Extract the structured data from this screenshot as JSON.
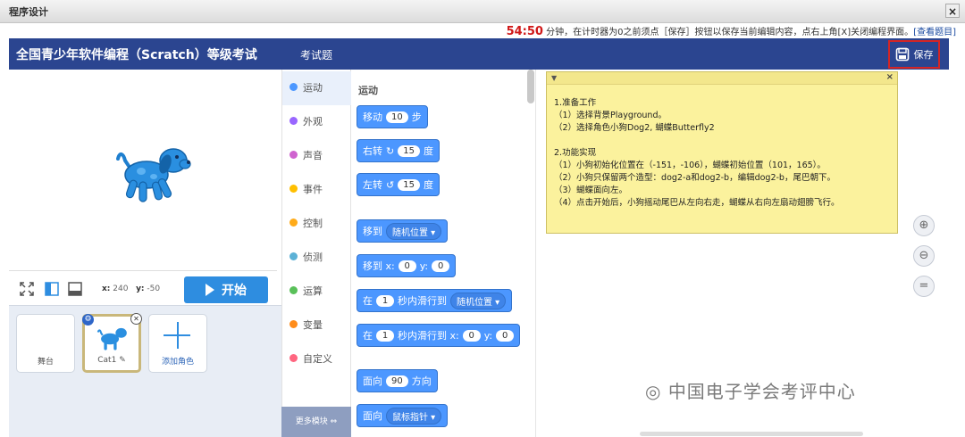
{
  "window": {
    "title": "程序设计",
    "close_label": "×"
  },
  "notice": {
    "timer": "54:50",
    "message": " 分钟，在计时器为0之前须点［保存］按钮以保存当前编辑内容，点右上角[X]关闭编程界面。",
    "link": "[查看题目]"
  },
  "header": {
    "title": "全国青少年软件编程（Scratch）等级考试",
    "tab": "考试题",
    "save_label": "保存"
  },
  "stage": {
    "coord_x_label": "x:",
    "coord_x": "240",
    "coord_y_label": "y:",
    "coord_y": "-50",
    "start_label": "开始"
  },
  "sprites": {
    "stage_label": "舞台",
    "sprite_name": "Cat1",
    "add_label": "添加角色"
  },
  "categories": [
    {
      "label": "运动",
      "color": "#4c97ff"
    },
    {
      "label": "外观",
      "color": "#9966ff"
    },
    {
      "label": "声音",
      "color": "#cf63cf"
    },
    {
      "label": "事件",
      "color": "#ffbf00"
    },
    {
      "label": "控制",
      "color": "#ffab19"
    },
    {
      "label": "侦测",
      "color": "#5cb1d6"
    },
    {
      "label": "运算",
      "color": "#59c059"
    },
    {
      "label": "变量",
      "color": "#ff8c1a"
    },
    {
      "label": "自定义",
      "color": "#ff6680"
    }
  ],
  "more_blocks": "更多模块",
  "palette": {
    "header": "运动",
    "move": {
      "a": "移动",
      "n": "10",
      "b": "步"
    },
    "turn_right": {
      "a": "右转",
      "n": "15",
      "b": "度"
    },
    "turn_left": {
      "a": "左转",
      "n": "15",
      "b": "度"
    },
    "goto": {
      "a": "移到",
      "dd": "随机位置"
    },
    "goto_xy": {
      "a": "移到 x:",
      "x": "0",
      "b": "y:",
      "y": "0"
    },
    "glide": {
      "a": "在",
      "n": "1",
      "b": "秒内滑行到",
      "dd": "随机位置"
    },
    "glide_xy": {
      "a": "在",
      "n": "1",
      "b": "秒内滑行到 x:",
      "x": "0",
      "c": "y:",
      "y": "0"
    },
    "point_dir": {
      "a": "面向",
      "n": "90",
      "b": "方向"
    },
    "point_towards": {
      "a": "面向",
      "dd": "鼠标指针"
    }
  },
  "note_lines": [
    "1.准备工作",
    "（1）选择背景Playground。",
    "（2）选择角色小狗Dog2, 蝴蝶Butterfly2",
    "",
    "2.功能实现",
    "（1）小狗初始化位置在（-151，-106），蝴蝶初始位置（101，165）。",
    "（2）小狗只保留两个造型：dog2-a和dog2-b，编辑dog2-b，尾巴朝下。",
    "（3）蝴蝶面向左。",
    "（4）点击开始后，小狗摇动尾巴从左向右走，蝴蝶从右向左扇动翅膀飞行。"
  ],
  "watermark": "中国电子学会考评中心"
}
